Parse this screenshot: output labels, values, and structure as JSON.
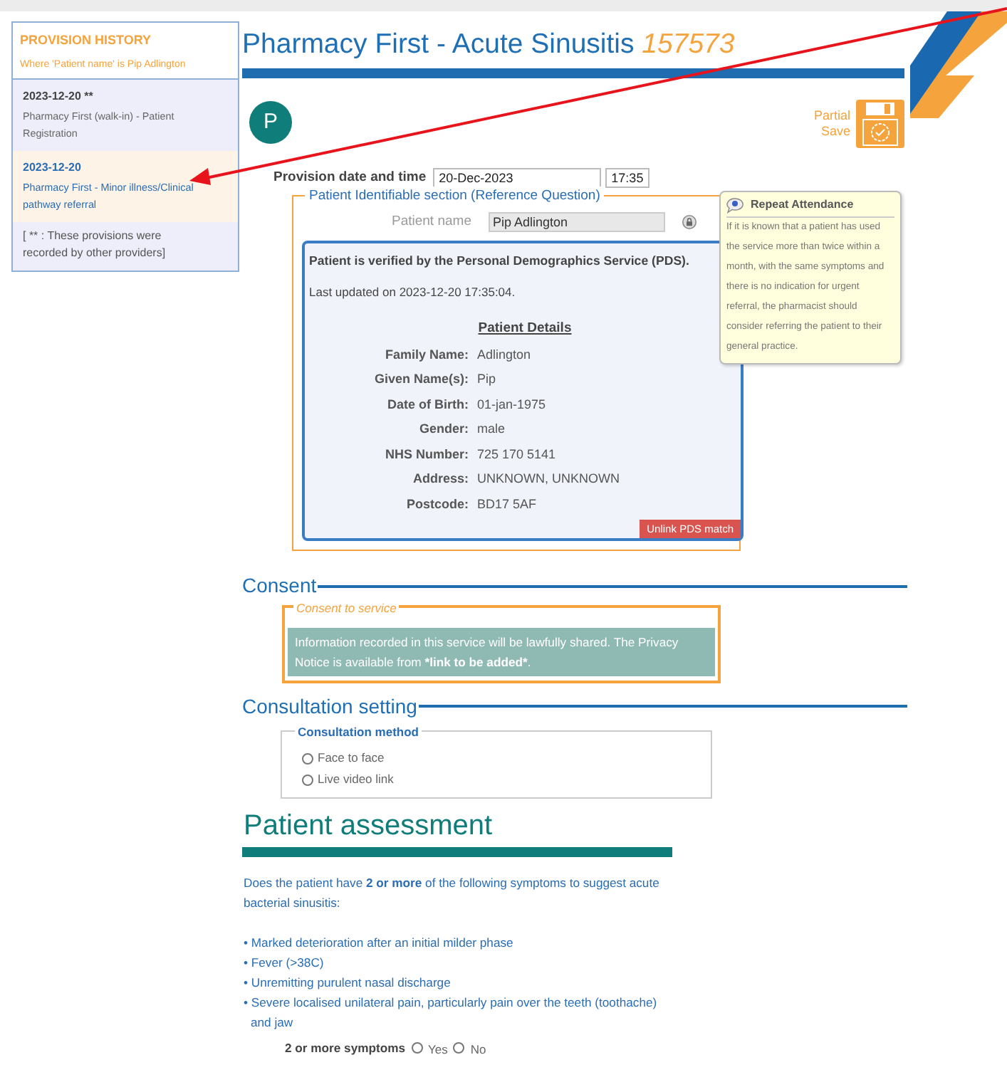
{
  "sidebar": {
    "title": "PROVISION HISTORY",
    "subtitle": "Where 'Patient name' is Pip Adlington",
    "items": [
      {
        "date": "2023-12-20 **",
        "description": "Pharmacy First (walk-in) - Patient Registration",
        "selected": false
      },
      {
        "date": "2023-12-20",
        "description": "Pharmacy First - Minor illness/Clinical pathway referral",
        "selected": true
      }
    ],
    "note": "[ ** : These provisions were recorded by other providers]"
  },
  "header": {
    "title": "Pharmacy First - Acute Sinusitis",
    "number": "157573",
    "avatar": "P",
    "partial_save": "Partial Save"
  },
  "provision": {
    "label": "Provision date and time",
    "date": "20-Dec-2023",
    "time": "17:35"
  },
  "patient_section": {
    "legend": "Patient Identifiable section (Reference Question)",
    "name_label": "Patient name",
    "name_value": "Pip Adlington",
    "pds": {
      "verified": "Patient is verified by the Personal Demographics Service (PDS).",
      "updated": "Last updated on 2023-12-20 17:35:04.",
      "details_title": "Patient Details",
      "fields": [
        {
          "label": "Family Name:",
          "value": "Adlington"
        },
        {
          "label": "Given Name(s):",
          "value": "Pip"
        },
        {
          "label": "Date of Birth:",
          "value": "01-jan-1975"
        },
        {
          "label": "Gender:",
          "value": "male"
        },
        {
          "label": "NHS Number:",
          "value": "725 170 5141"
        },
        {
          "label": "Address:",
          "value": "UNKNOWN, UNKNOWN"
        },
        {
          "label": "Postcode:",
          "value": "BD17 5AF"
        }
      ],
      "unlink_button": "Unlink PDS match"
    }
  },
  "tooltip": {
    "title": "Repeat Attendance",
    "text": "If it is known that a patient has used the service more than twice within a month, with the same symptoms and there is no indication for urgent referral, the pharmacist should consider referring the patient to their general practice."
  },
  "consent": {
    "heading": "Consent",
    "legend": "Consent to service",
    "notice_text": "Information recorded in this service will be lawfully shared. The Privacy Notice is available from ",
    "notice_bold": "*link to be added*",
    "notice_end": "."
  },
  "consultation": {
    "heading": "Consultation setting",
    "legend": "Consultation method",
    "options": [
      {
        "label": "Face to face",
        "checked": false
      },
      {
        "label": "Live video link",
        "checked": false
      }
    ]
  },
  "assessment": {
    "heading": "Patient assessment",
    "question": "Does the patient have **2 or more** of the following symptoms to suggest acute bacterial sinusitis:",
    "symptoms": [
      "• Marked deterioration after an initial milder phase",
      "• Fever (>38C)",
      "• Unremitting purulent nasal discharge",
      "• Severe localised unilateral pain, particularly pain over the teeth (toothache) and jaw"
    ],
    "answer_label": "2 or more symptoms",
    "answers": [
      {
        "label": "Yes",
        "checked": false
      },
      {
        "label": "No",
        "checked": false
      }
    ]
  }
}
